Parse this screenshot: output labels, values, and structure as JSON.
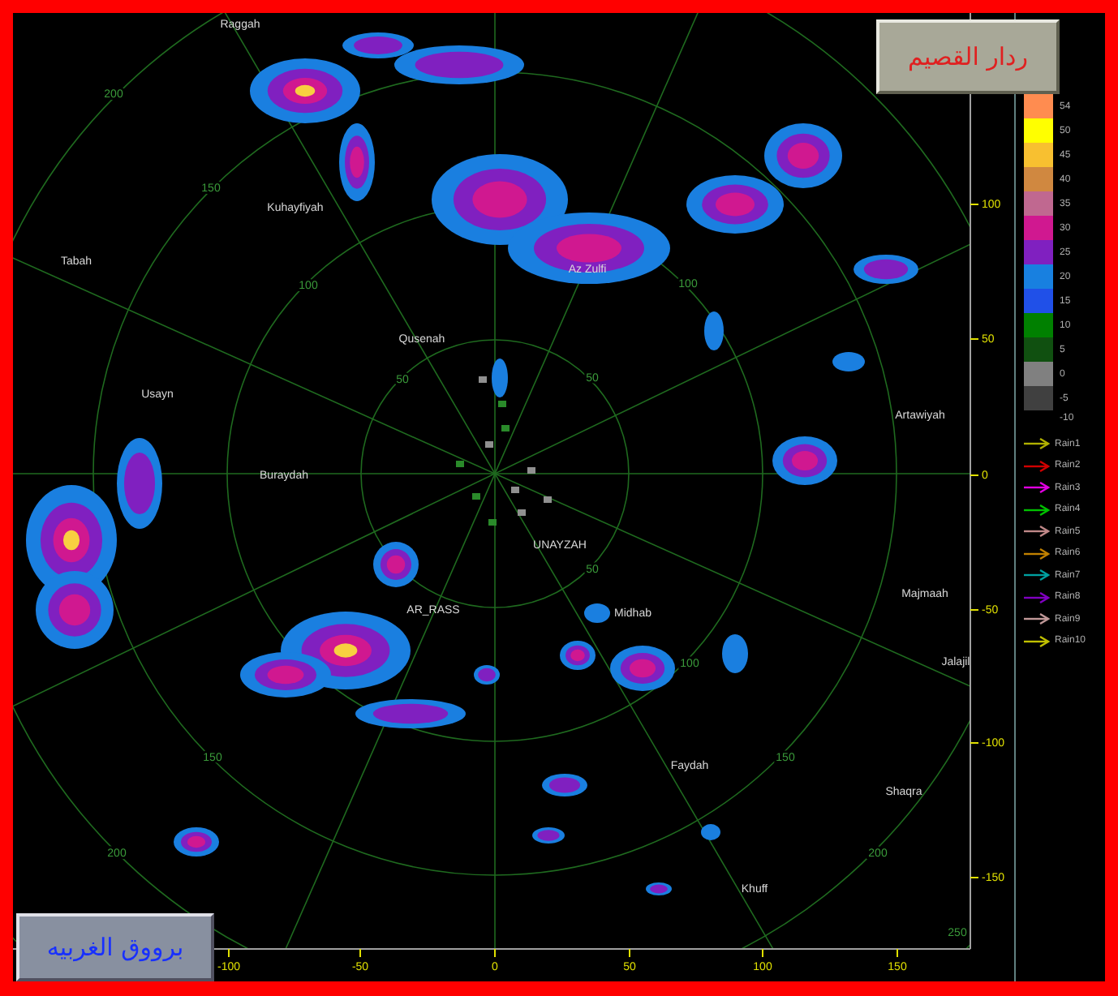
{
  "title": "ردار القصيم",
  "caption": "برووق الغربيه",
  "place_names": [
    "Raggah",
    "Kuhayfiyah",
    "Tabah",
    "Usayn",
    "Qusenah",
    "Buraydah",
    "UNAYZAH",
    "AR_RASS",
    "Midhab",
    "Az Zulfi",
    "Artawiyah",
    "Majmaah",
    "Jalajil",
    "Faydah",
    "Shaqra",
    "Khuff"
  ],
  "range_labels": [
    "200",
    "150",
    "100",
    "50",
    "50",
    "100",
    "50",
    "100",
    "150",
    "200",
    "250",
    "150",
    "200"
  ],
  "axis": {
    "y_labels": [
      "100",
      "50",
      "0",
      "-50",
      "-100",
      "-150"
    ],
    "x_labels": [
      "-100",
      "-50",
      "0",
      "50",
      "100",
      "150"
    ]
  },
  "color_scale": {
    "bins": [
      {
        "label": "54",
        "color": "#ff8c50"
      },
      {
        "label": "50",
        "color": "#ffff00"
      },
      {
        "label": "45",
        "color": "#f8c030"
      },
      {
        "label": "40",
        "color": "#d08840"
      },
      {
        "label": "35",
        "color": "#c06890"
      },
      {
        "label": "30",
        "color": "#d01890"
      },
      {
        "label": "25",
        "color": "#8020c0"
      },
      {
        "label": "20",
        "color": "#1880e0"
      },
      {
        "label": "15",
        "color": "#2050e8"
      },
      {
        "label": "10",
        "color": "#008000"
      },
      {
        "label": "5",
        "color": "#105010"
      },
      {
        "label": "0",
        "color": "#808080"
      },
      {
        "label": "-5",
        "color": "#404040"
      }
    ],
    "bottom_label": "-10"
  },
  "storm_tracks": [
    {
      "label": "Rain1",
      "color": "#b0b000"
    },
    {
      "label": "Rain2",
      "color": "#d00000"
    },
    {
      "label": "Rain3",
      "color": "#e000e0"
    },
    {
      "label": "Rain4",
      "color": "#00c000"
    },
    {
      "label": "Rain5",
      "color": "#c08888"
    },
    {
      "label": "Rain6",
      "color": "#c08000"
    },
    {
      "label": "Rain7",
      "color": "#00a0a0"
    },
    {
      "label": "Rain8",
      "color": "#8000c0"
    },
    {
      "label": "Rain9",
      "color": "#c09898"
    },
    {
      "label": "Rain10",
      "color": "#c0c000"
    }
  ]
}
